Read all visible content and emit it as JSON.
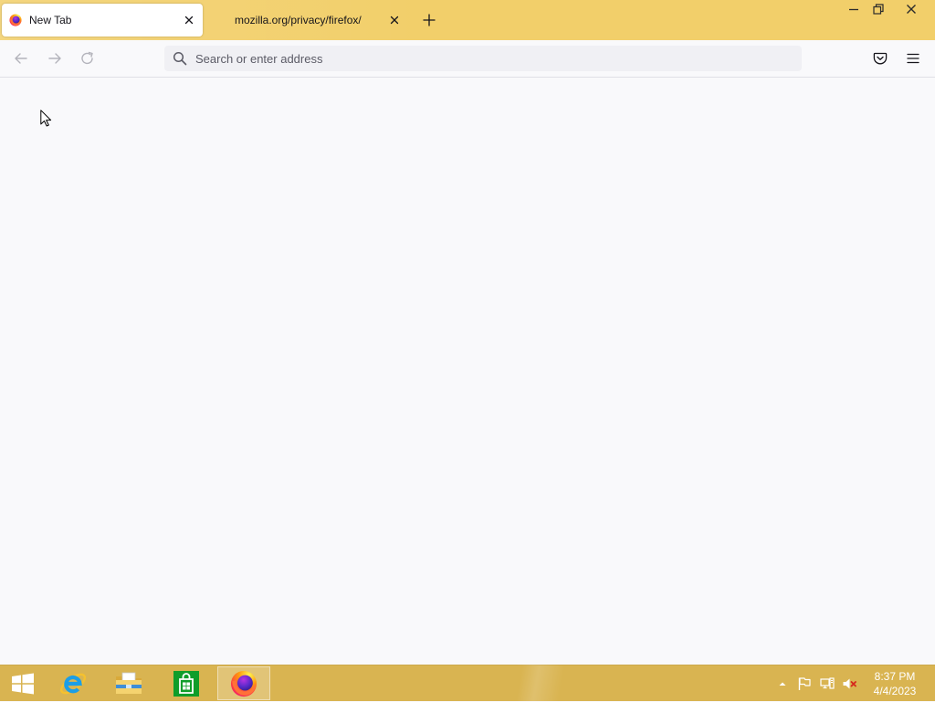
{
  "colors": {
    "titlebar": "#f2cf6a",
    "taskbar": "#d9b451",
    "toolbar": "#f9f9fb",
    "content": "#f9f9fb",
    "urlbar": "#f0f0f4"
  },
  "tabs": [
    {
      "label": "New Tab",
      "active": true,
      "icon": "firefox-icon",
      "close_icon": "close-icon"
    },
    {
      "label": "mozilla.org/privacy/firefox/",
      "active": false,
      "close_icon": "close-icon"
    }
  ],
  "tabstrip": {
    "new_tab_icon": "plus-icon"
  },
  "window_controls": {
    "minimize_icon": "minimize-icon",
    "restore_icon": "restore-icon",
    "close_icon": "close-icon"
  },
  "navbar": {
    "back_icon": "back-arrow-icon",
    "forward_icon": "forward-arrow-icon",
    "reload_icon": "reload-icon",
    "pocket_icon": "pocket-icon",
    "menu_icon": "hamburger-menu-icon"
  },
  "urlbar": {
    "icon": "search-icon",
    "placeholder": "Search or enter address",
    "value": ""
  },
  "taskbar": {
    "start_icon": "windows-start-icon",
    "pinned_icons": [
      "internet-explorer-icon",
      "file-explorer-icon",
      "store-icon",
      "firefox-icon"
    ],
    "active_app_icon": "firefox-icon",
    "tray_icons": [
      "show-hidden-icons-icon",
      "action-center-flag-icon",
      "network-icon",
      "volume-muted-icon"
    ],
    "clock": {
      "time": "8:37 PM",
      "date": "4/4/2023"
    }
  }
}
